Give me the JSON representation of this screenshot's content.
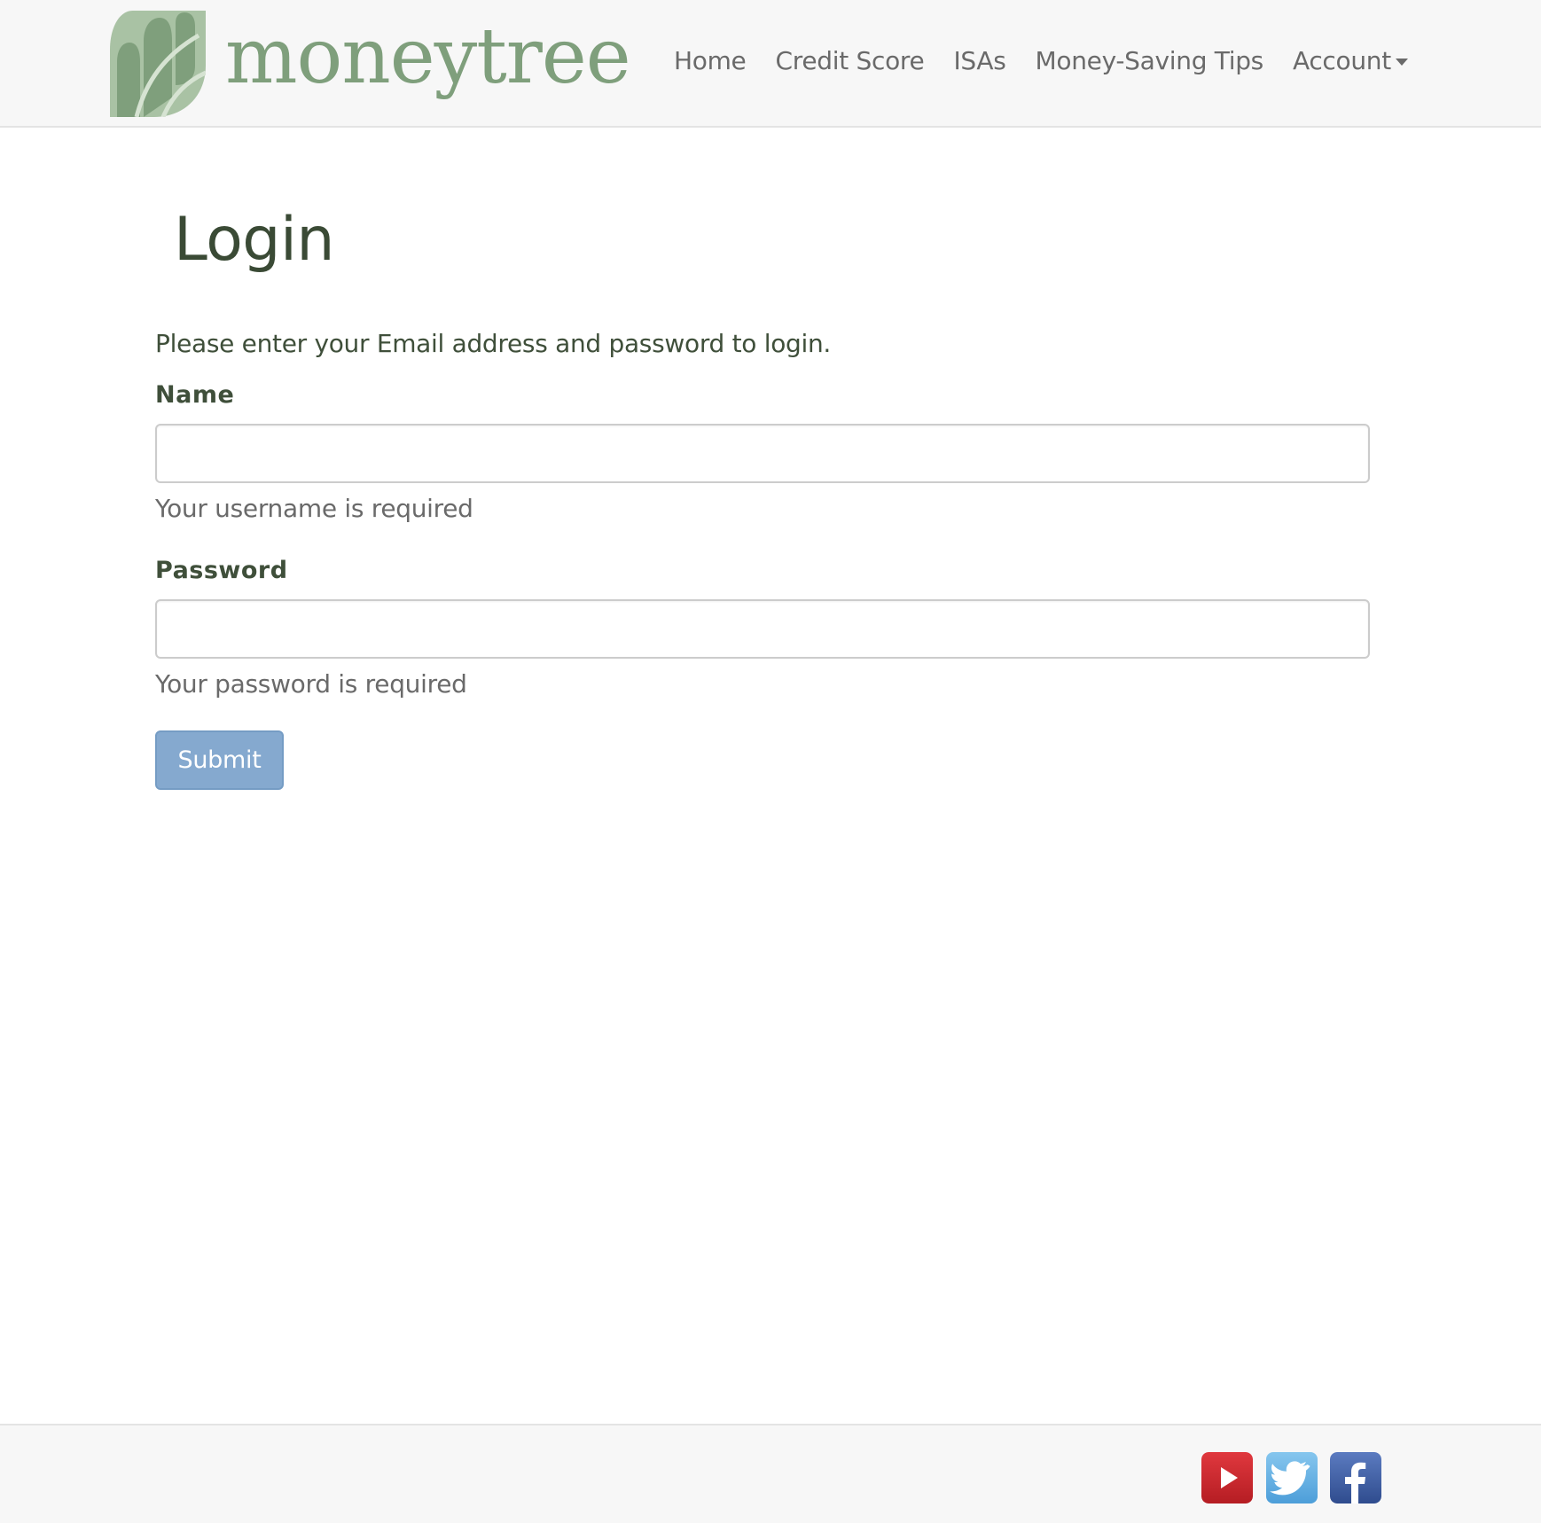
{
  "header": {
    "brand_name": "moneytree",
    "nav_items": [
      "Home",
      "Credit Score",
      "ISAs",
      "Money-Saving Tips"
    ],
    "account_label": "Account"
  },
  "main": {
    "title": "Login",
    "intro": "Please enter your Email address and password to login.",
    "name_label": "Name",
    "name_value": "",
    "name_help": "Your username is required",
    "password_label": "Password",
    "password_value": "",
    "password_help": "Your password is required",
    "submit_label": "Submit"
  },
  "footer": {
    "social_icons": [
      "youtube-icon",
      "twitter-icon",
      "facebook-icon"
    ]
  },
  "colors": {
    "brand_green": "#7f9f7c",
    "heading_green": "#3a4a35",
    "submit_blue": "#85a9cf",
    "youtube_red": "#c8232a",
    "twitter_blue": "#5eaae0",
    "facebook_blue": "#3b5a9a"
  }
}
